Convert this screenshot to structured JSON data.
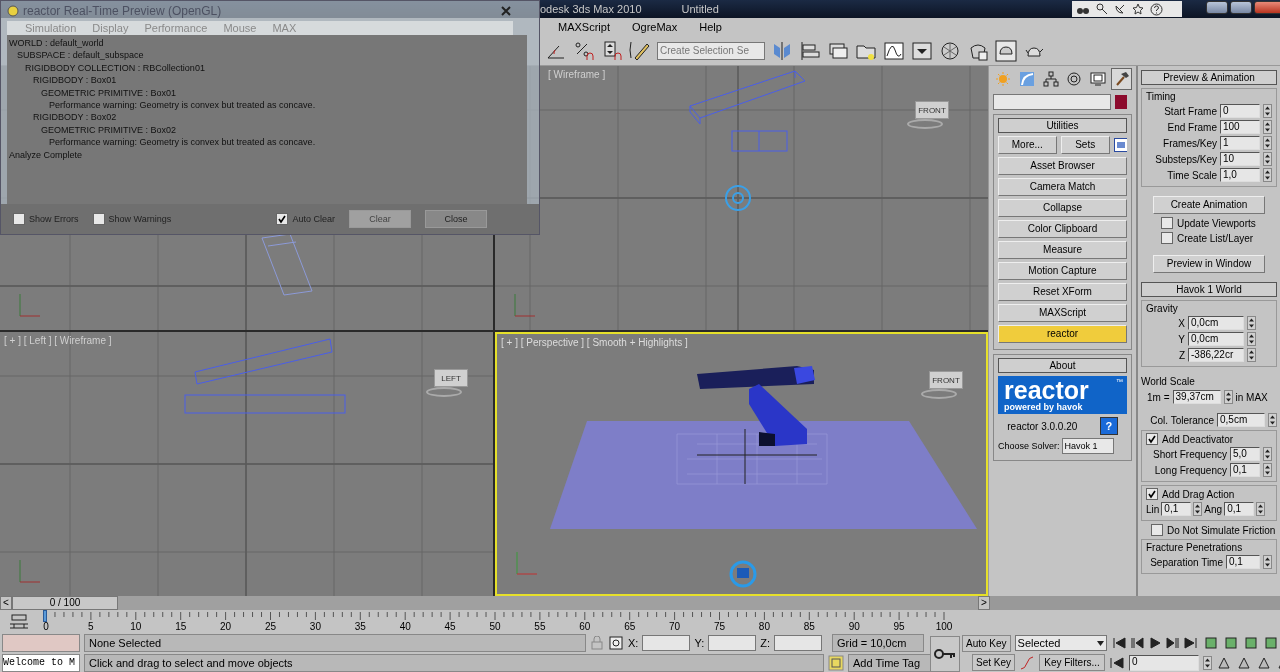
{
  "title_bar": {
    "app_title": "odesk 3ds Max 2010",
    "document": "Untitled"
  },
  "menu": [
    "MAXScript",
    "OgreMax",
    "Help"
  ],
  "toolbar": {
    "selection_set": {
      "placeholder": "Create Selection Se"
    }
  },
  "viewports": [
    {
      "kind": "top",
      "active": false
    },
    {
      "kind": "front",
      "label": "[ Wireframe ]",
      "cube": "FRONT",
      "active": false
    },
    {
      "kind": "left",
      "label": "[ + ] [ Left ] [ Wireframe ]",
      "cube": "LEFT",
      "active": false
    },
    {
      "kind": "perspective",
      "label": "[ + ] [ Perspective ] [ Smooth + Highlights ]",
      "cube": "FRONT",
      "active": true
    }
  ],
  "messages_window": {
    "title": "reactor Real-Time Preview (OpenGL)",
    "menu": [
      "Simulation",
      "Display",
      "Performance",
      "Mouse",
      "MAX"
    ],
    "lines": [
      {
        "text": "WORLD : default_world",
        "children": [
          {
            "text": "SUBSPACE : default_subspace",
            "children": [
              {
                "text": "RIGIDBODY COLLECTION : RBCollection01",
                "children": [
                  {
                    "text": "RIGIDBODY : Box01",
                    "children": [
                      {
                        "text": "GEOMETRIC PRIMITIVE : Box01",
                        "children": [
                          {
                            "text": "Performance warning: Geometry is convex but treated as concave."
                          }
                        ]
                      }
                    ]
                  },
                  {
                    "text": "RIGIDBODY : Box02",
                    "children": [
                      {
                        "text": "GEOMETRIC PRIMITIVE : Box02",
                        "children": [
                          {
                            "text": "Performance warning: Geometry is convex but treated as concave."
                          }
                        ]
                      }
                    ]
                  }
                ]
              }
            ]
          }
        ]
      },
      {
        "text": "Analyze Complete"
      }
    ],
    "checkboxes": [
      {
        "label": "Show Errors",
        "checked": false
      },
      {
        "label": "Show Warnings",
        "checked": false
      },
      {
        "label": "Auto Clear",
        "checked": true
      }
    ],
    "buttons": [
      {
        "label": "Clear",
        "disabled": true
      },
      {
        "label": "Close",
        "disabled": false
      }
    ]
  },
  "command_tabs": [
    {
      "kind": "create",
      "selected": false
    },
    {
      "kind": "modify",
      "selected": false
    },
    {
      "kind": "hierarchy",
      "selected": false
    },
    {
      "kind": "motion",
      "selected": false
    },
    {
      "kind": "display",
      "selected": false
    },
    {
      "kind": "utilities",
      "selected": true
    }
  ],
  "utilities": {
    "title": "Utilities",
    "more": "More...",
    "sets": "Sets",
    "items": [
      {
        "label": "Asset Browser",
        "selected": false
      },
      {
        "label": "Camera Match",
        "selected": false
      },
      {
        "label": "Collapse",
        "selected": false
      },
      {
        "label": "Color Clipboard",
        "selected": false
      },
      {
        "label": "Measure",
        "selected": false
      },
      {
        "label": "Motion Capture",
        "selected": false
      },
      {
        "label": "Reset XForm",
        "selected": false
      },
      {
        "label": "MAXScript",
        "selected": false
      },
      {
        "label": "reactor",
        "selected": true
      }
    ]
  },
  "about": {
    "title": "About",
    "logo": {
      "word": "reactor",
      "tm": "™",
      "tagline": "powered by havok"
    },
    "version": "reactor 3.0.0.20",
    "help": "?",
    "solver_label": "Choose Solver:",
    "solver": "Havok 1"
  },
  "preview": {
    "title": "Preview & Animation",
    "group": "Timing",
    "fields": [
      {
        "label": "Start Frame",
        "value": "0"
      },
      {
        "label": "End Frame",
        "value": "100"
      },
      {
        "label": "Frames/Key",
        "value": "1"
      },
      {
        "label": "Substeps/Key",
        "value": "10"
      },
      {
        "label": "Time Scale",
        "value": "1,0"
      }
    ],
    "create_button": "Create Animation",
    "checks": [
      {
        "label": "Update Viewports",
        "checked": false
      },
      {
        "label": "Create List/Layer",
        "checked": false
      }
    ],
    "preview_button": "Preview in Window"
  },
  "world": {
    "title": "Havok 1 World",
    "gravity": {
      "title": "Gravity",
      "fields": [
        {
          "label": "X",
          "value": "0,0cm"
        },
        {
          "label": "Y",
          "value": "0,0cm"
        },
        {
          "label": "Z",
          "value": "-386,22cr"
        }
      ]
    },
    "world_scale": {
      "title": "World Scale",
      "prefix": "1m =",
      "value": "39,37cm",
      "suffix": "in MAX"
    },
    "tolerance": {
      "label": "Col. Tolerance",
      "value": "0,5cm"
    },
    "deactivator": {
      "label": "Add Deactivator",
      "checked": true,
      "fields": [
        {
          "label": "Short Frequency",
          "value": "5,0"
        },
        {
          "label": "Long Frequency",
          "value": "0,1"
        }
      ]
    },
    "drag": {
      "label": "Add Drag Action",
      "checked": true,
      "fields": [
        {
          "label": "Lin",
          "value": "0,1"
        },
        {
          "label": "Ang",
          "value": "0,1"
        }
      ]
    },
    "friction": {
      "label": "Do Not Simulate Friction",
      "checked": false
    },
    "fracture": {
      "title": "Fracture Penetrations",
      "fields": [
        {
          "label": "Separation Time",
          "value": "0,1"
        }
      ]
    }
  },
  "time_slider": {
    "label": "0 / 100",
    "prev": "<",
    "next": ">",
    "level": 0
  },
  "ruler_labels": [
    "0",
    "5",
    "10",
    "15",
    "20",
    "25",
    "30",
    "35",
    "40",
    "45",
    "50",
    "55",
    "60",
    "65",
    "70",
    "75",
    "80",
    "85",
    "90",
    "95",
    "100"
  ],
  "status": {
    "listener": {
      "value": "Welcome to M"
    },
    "selection": "None Selected",
    "prompt": "Click and drag to select and move objects",
    "coords": [
      {
        "label": "X:"
      },
      {
        "label": "Y:"
      },
      {
        "label": "Z:"
      }
    ],
    "grid": "Grid = 10,0cm",
    "time_tag": "Add Time Tag",
    "auto_key": {
      "label": "Auto Key",
      "on": false
    },
    "set_key": "Set Key",
    "key_mode": "Selected",
    "key_filters": "Key Filters...",
    "frame": "0"
  }
}
